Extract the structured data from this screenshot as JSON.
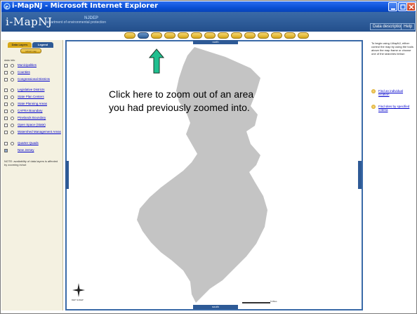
{
  "window": {
    "title": "i-MapNJ - Microsoft Internet Explorer"
  },
  "header": {
    "logo": "i-MapNJ",
    "tagline_small": "department of environmental protection",
    "tagline_highlight": "NJDEP",
    "links": {
      "data_descriptions": "Data descriptions",
      "help": "Help"
    }
  },
  "toolbar": {
    "active_index": 1,
    "tools": [
      "",
      "",
      "",
      "",
      "",
      "",
      "",
      "",
      "",
      "",
      "",
      "",
      "",
      ""
    ]
  },
  "left_panel": {
    "tabs": {
      "data_layers": "Data Layers",
      "legend": "Legend"
    },
    "refresh_label": "refresh map",
    "data_info_label": "data info",
    "layers": [
      {
        "label": "Municipalities"
      },
      {
        "label": "Counties"
      },
      {
        "label": "Congressional Districts"
      },
      {
        "label": "Legislative Districts"
      },
      {
        "label": "State Plan Centers"
      },
      {
        "label": "State Planning Areas"
      },
      {
        "label": "CAFRA Boundary"
      },
      {
        "label": "Pinelands Boundary"
      },
      {
        "label": "Open Space (State)"
      },
      {
        "label": "Watershed Management Areas"
      },
      {
        "label": "Quarter Quads"
      },
      {
        "label": "New Jersey"
      }
    ],
    "note": "NOTE: availability of data layers is affected by zooming in/out"
  },
  "map": {
    "north_label": "north",
    "south_label": "south",
    "compass_label": "DEP NJDEP",
    "scale_label": "5 Miles",
    "state_fill": "#c4c4c4",
    "frame_color": "#3a6aa8"
  },
  "annotation": {
    "line1": "Click here to zoom out of an area",
    "line2": "you had previously zoomed into.",
    "arrow_color": "#1fbf8f"
  },
  "right_panel": {
    "intro": "To begin using i-MapNJ, either control the map by using the tools above the map frame or choose one of the searches below:",
    "links": [
      {
        "label": "Find an individual location"
      },
      {
        "label": "Find sites by specified criteria"
      }
    ]
  }
}
